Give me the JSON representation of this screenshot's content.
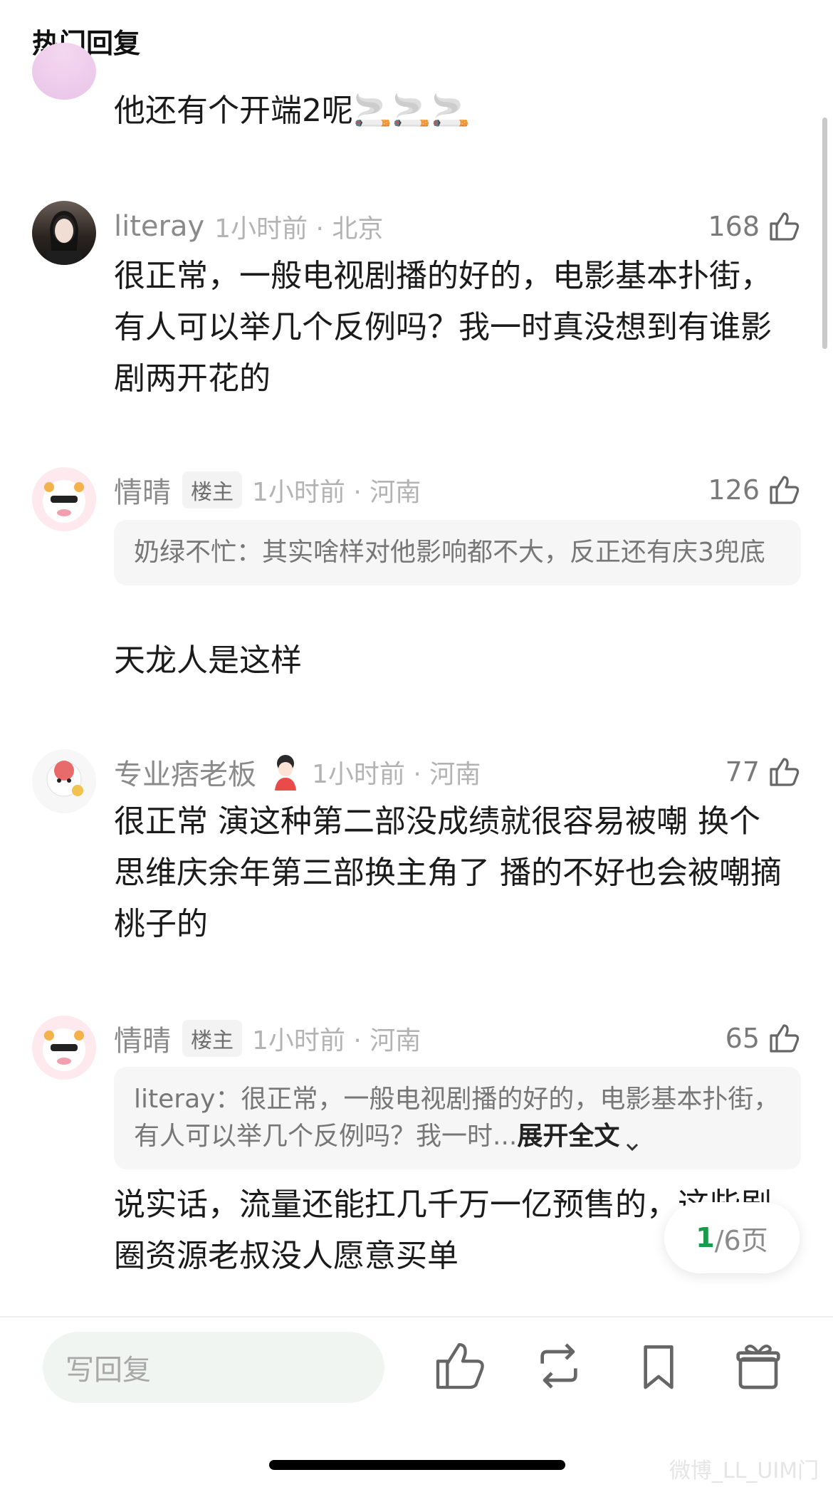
{
  "header": {
    "title": "热门回复"
  },
  "comments": [
    {
      "text": "他还有个开端2呢🚬🚬🚬"
    },
    {
      "username": "literay",
      "time": "1小时前 · 北京",
      "likes": "168",
      "text": "很正常，一般电视剧播的好的，电影基本扑街，有人可以举几个反例吗？我一时真没想到有谁影剧两开花的"
    },
    {
      "username": "情晴",
      "tag": "楼主",
      "time": "1小时前 · 河南",
      "likes": "126",
      "quote": "奶绿不忙：其实啥样对他影响都不大，反正还有庆3兜底",
      "text": "天龙人是这样"
    },
    {
      "username": "专业痞老板",
      "time": "1小时前 · 河南",
      "likes": "77",
      "text": "很正常 演这种第二部没成绩就很容易被嘲 换个思维庆余年第三部换主角了 播的不好也会被嘲摘桃子的"
    },
    {
      "username": "情晴",
      "tag": "楼主",
      "time": "1小时前 · 河南",
      "likes": "65",
      "quote": "literay：很正常，一般电视剧播的好的，电影基本扑街，有人可以举几个反例吗？我一时...",
      "quote_expand": "展开全文",
      "text": "说实话，流量还能扛几千万一亿预售的，这些剧圈资源老叔没人愿意买单"
    }
  ],
  "pager": {
    "current": "1",
    "total": "/6页"
  },
  "bottom_bar": {
    "reply_placeholder": "写回复"
  },
  "watermark": "微博_LL_UIM门",
  "colors": {
    "accent_green": "#1a9a4b",
    "meta_gray": "#8a8a8a"
  }
}
